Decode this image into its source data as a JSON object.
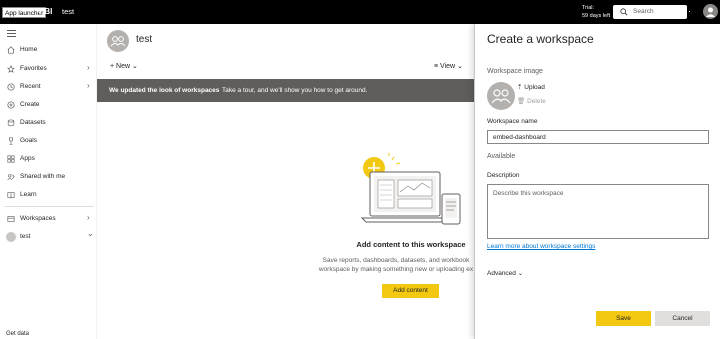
{
  "topbar": {
    "app_launcher_tooltip": "App launcher",
    "app_name": "r BI",
    "workspace_crumb": "test",
    "trial_label": "Trial:",
    "trial_days": "59 days left",
    "search_placeholder": "Search",
    "more": "···"
  },
  "sidebar": {
    "items": [
      {
        "label": "Home",
        "icon": "home-icon"
      },
      {
        "label": "Favorites",
        "icon": "star-icon",
        "chevron": "›"
      },
      {
        "label": "Recent",
        "icon": "clock-icon",
        "chevron": "›"
      },
      {
        "label": "Create",
        "icon": "plus-icon"
      },
      {
        "label": "Datasets",
        "icon": "database-icon"
      },
      {
        "label": "Goals",
        "icon": "trophy-icon"
      },
      {
        "label": "Apps",
        "icon": "apps-icon"
      },
      {
        "label": "Shared with me",
        "icon": "shared-icon"
      },
      {
        "label": "Learn",
        "icon": "book-icon"
      },
      {
        "label": "Workspaces",
        "icon": "workspaces-icon",
        "chevron": "›"
      },
      {
        "label": "test",
        "icon": "workspace-avatar",
        "chevron": "⌄"
      }
    ],
    "get_data": "Get data"
  },
  "workspace": {
    "title": "test",
    "new_label": "New",
    "view_label": "View"
  },
  "banner": {
    "headline": "We updated the look of workspaces",
    "text": "Take a tour, and we'll show you how to get around."
  },
  "empty_state": {
    "title": "Add content to this workspace",
    "desc_line1": "Save reports, dashboards, datasets, and workbook",
    "desc_line2": "workspace by making something new or uploading ex",
    "button": "Add content"
  },
  "panel": {
    "title": "Create a workspace",
    "image_label": "Workspace image",
    "upload": "Upload",
    "delete": "Delete",
    "name_label": "Workspace name",
    "name_value": "embed-dashboard",
    "availability": "Available",
    "description_label": "Description",
    "description_placeholder": "Describe this workspace",
    "learn_more": "Learn more about workspace settings",
    "advanced": "Advanced",
    "save": "Save",
    "cancel": "Cancel"
  },
  "colors": {
    "accent_yellow": "#f2c811",
    "banner_gray": "#605e5c",
    "link_blue": "#0078d4",
    "topbar": "#000000"
  }
}
